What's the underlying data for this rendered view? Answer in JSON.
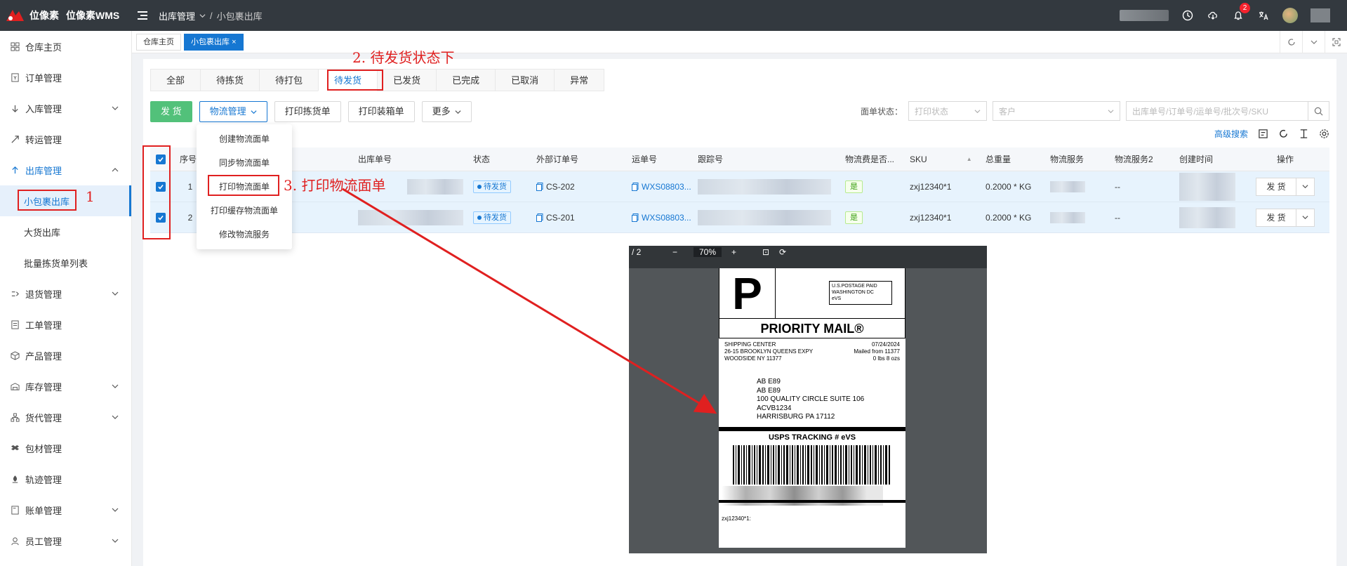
{
  "topbar": {
    "logo_text": "位像素",
    "logo_wms": "位像素WMS",
    "breadcrumb": [
      "出库管理",
      "小包裹出库"
    ],
    "notification_count": "2"
  },
  "sidebar": {
    "items": [
      {
        "label": "仓库主页",
        "icon": "grid-icon"
      },
      {
        "label": "订单管理",
        "icon": "order-icon"
      },
      {
        "label": "入库管理",
        "icon": "inbound-icon"
      },
      {
        "label": "转运管理",
        "icon": "transfer-icon"
      },
      {
        "label": "出库管理",
        "icon": "outbound-icon"
      },
      {
        "label": "退货管理",
        "icon": "return-icon"
      },
      {
        "label": "工单管理",
        "icon": "ticket-icon"
      },
      {
        "label": "产品管理",
        "icon": "product-icon"
      },
      {
        "label": "库存管理",
        "icon": "inventory-icon"
      },
      {
        "label": "货代管理",
        "icon": "forwarder-icon"
      },
      {
        "label": "包材管理",
        "icon": "packaging-icon"
      },
      {
        "label": "轨迹管理",
        "icon": "track-icon"
      },
      {
        "label": "账单管理",
        "icon": "bill-icon"
      },
      {
        "label": "员工管理",
        "icon": "staff-icon"
      }
    ],
    "sub_outbound": [
      "小包裹出库",
      "大货出库",
      "批量拣货单列表"
    ]
  },
  "page_tabs": [
    "仓库主页",
    "小包裹出库"
  ],
  "status_tabs": [
    "全部",
    "待拣货",
    "待打包",
    "待发货",
    "已发货",
    "已完成",
    "已取消",
    "异常"
  ],
  "toolbar": {
    "ship": "发 货",
    "logistics": "物流管理",
    "print_pick": "打印拣货单",
    "print_box": "打印装箱单",
    "more": "更多"
  },
  "filters": {
    "label_status": "面单状态：",
    "print_status_placeholder": "打印状态",
    "customer_placeholder": "客户",
    "search_placeholder": "出库单号/订单号/运单号/批次号/SKU",
    "advanced": "高级搜索"
  },
  "dropdown": [
    "创建物流面单",
    "同步物流面单",
    "打印物流面单",
    "打印缓存物流面单",
    "修改物流服务"
  ],
  "table": {
    "headers": [
      "序号",
      "出库单号",
      "状态",
      "外部订单号",
      "运单号",
      "跟踪号",
      "物流费是否...",
      "SKU",
      "总重量",
      "物流服务",
      "物流服务2",
      "创建时间",
      "操作"
    ],
    "rows": [
      {
        "index": "1",
        "status": "待发货",
        "external_no": "CS-202",
        "waybill": "WXS08803...",
        "fee": "是",
        "sku": "zxj12340*1",
        "weight": "0.2000 * KG",
        "service2": "--",
        "op": "发 货"
      },
      {
        "index": "2",
        "status": "待发货",
        "external_no": "CS-201",
        "waybill": "WXS08803...",
        "fee": "是",
        "sku": "zxj12340*1",
        "weight": "0.2000 * KG",
        "service2": "--",
        "op": "发 货"
      }
    ]
  },
  "annotations": {
    "step1": "1",
    "step2": "2. 待发货状态下",
    "step3": "3. 打印物流面单"
  },
  "preview": {
    "page": "/ 2",
    "zoom": "70%",
    "label": {
      "p": "P",
      "postage": [
        "U.S.POSTAGE PAID",
        "WASHINGTON DC",
        "eVS"
      ],
      "priority": "PRIORITY MAIL®",
      "from": [
        "SHIPPING CENTER",
        "26-15 BROOKLYN QUEENS EXPY",
        "WOODSIDE NY 11377"
      ],
      "date": [
        "07/24/2024",
        "Mailed from 11377",
        "0 lbs 8 ozs"
      ],
      "to": [
        "AB E89",
        "AB E89",
        "100 QUALITY CIRCLE SUITE 106",
        "ACVB1234",
        "HARRISBURG PA 17112"
      ],
      "tracking": "USPS TRACKING # eVS",
      "sku": "zxj12340*1:"
    }
  },
  "colors": {
    "primary": "#1677d2",
    "green": "#52c17a",
    "annotation_red": "#e02020",
    "topbar": "#33393f"
  }
}
